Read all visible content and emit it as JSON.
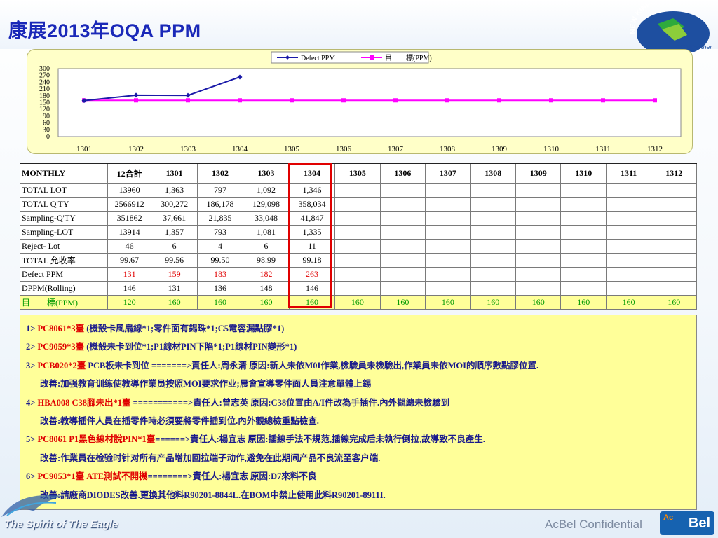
{
  "title": "康展2013年OQA PPM",
  "logo": {
    "arc_text": "NEW KINPO VALUE",
    "side_text_1": "COM",
    "side_text_2": "Partner"
  },
  "chart_data": {
    "type": "line",
    "categories": [
      "1301",
      "1302",
      "1303",
      "1304",
      "1305",
      "1306",
      "1307",
      "1308",
      "1309",
      "1310",
      "1311",
      "1312"
    ],
    "series": [
      {
        "name": "Defect PPM",
        "values": [
          159,
          183,
          182,
          263,
          null,
          null,
          null,
          null,
          null,
          null,
          null,
          null
        ],
        "color": "#1a1aa8"
      },
      {
        "name": "目　　標(PPM)",
        "values": [
          160,
          160,
          160,
          160,
          160,
          160,
          160,
          160,
          160,
          160,
          160,
          160
        ],
        "color": "#ff00ff"
      }
    ],
    "yticks": [
      "300",
      "270",
      "240",
      "210",
      "180",
      "150",
      "120",
      "90",
      "60",
      "30",
      "0"
    ],
    "ylim": [
      0,
      300
    ],
    "legend": "top-center",
    "grid": false
  },
  "table": {
    "headers": [
      "MONTHLY",
      "12合計",
      "1301",
      "1302",
      "1303",
      "1304",
      "1305",
      "1306",
      "1307",
      "1308",
      "1309",
      "1310",
      "1311",
      "1312"
    ],
    "rows": [
      {
        "label": "TOTAL  LOT",
        "cells": [
          "13960",
          "1,363",
          "797",
          "1,092",
          "1,346",
          "",
          "",
          "",
          "",
          "",
          "",
          "",
          ""
        ]
      },
      {
        "label": "TOTAL Q'TY",
        "cells": [
          "2566912",
          "300,272",
          "186,178",
          "129,098",
          "358,034",
          "",
          "",
          "",
          "",
          "",
          "",
          "",
          ""
        ]
      },
      {
        "label": "Sampling-Q'TY",
        "cells": [
          "351862",
          "37,661",
          "21,835",
          "33,048",
          "41,847",
          "",
          "",
          "",
          "",
          "",
          "",
          "",
          ""
        ]
      },
      {
        "label": "Sampling-LOT",
        "cells": [
          "13914",
          "1,357",
          "793",
          "1,081",
          "1,335",
          "",
          "",
          "",
          "",
          "",
          "",
          "",
          ""
        ]
      },
      {
        "label": "Reject- Lot",
        "cells": [
          "46",
          "6",
          "4",
          "6",
          "11",
          "",
          "",
          "",
          "",
          "",
          "",
          "",
          ""
        ]
      },
      {
        "label": "TOTAL 允收率",
        "cells": [
          "99.67",
          "99.56",
          "99.50",
          "98.99",
          "99.18",
          "",
          "",
          "",
          "",
          "",
          "",
          "",
          ""
        ]
      },
      {
        "label": "Defect PPM",
        "cells": [
          "131",
          "159",
          "183",
          "182",
          "263",
          "",
          "",
          "",
          "",
          "",
          "",
          "",
          ""
        ]
      },
      {
        "label": "DPPM(Rolling)",
        "cells": [
          "146",
          "131",
          "136",
          "148",
          "146",
          "",
          "",
          "",
          "",
          "",
          "",
          "",
          ""
        ]
      },
      {
        "label": "目　　標(PPM)",
        "cells": [
          "120",
          "160",
          "160",
          "160",
          "160",
          "160",
          "160",
          "160",
          "160",
          "160",
          "160",
          "160",
          "160"
        ]
      }
    ]
  },
  "notes": [
    {
      "prefix": "1> ",
      "red": "PC8061*3臺",
      "rest": " (機殼卡風扇線*1;零件面有錫珠*1;C5電容漏點膠*1)"
    },
    {
      "prefix": "2> ",
      "red": "PC9059*3臺",
      "rest": " (機殼未卡到位*1;P1線材PIN下陷*1;P1線材PIN變形*1)"
    },
    {
      "prefix": "3> ",
      "red": "PCB020*2臺",
      "rest": " PCB板未卡到位 =======>責任人:周永清 原因:新人未依M0I作業,檢驗員未檢驗出,作業員未依MOI的順序數點膠位置."
    },
    {
      "sub": "改善:加强教育训练使教導作業员按照MOI要求作业;晨會宣導零件面人員注意單體上錫"
    },
    {
      "prefix": "4> ",
      "red": "HBA008 C38腳未出*1臺",
      "rest": " ===========>責任人:曾志英 原因:C38位置由A/I件改為手插件.內外觀總未檢驗到"
    },
    {
      "sub": "改善:教導插件人員在插零件時必須要將零件插到位.內外觀總檢重點檢查."
    },
    {
      "prefix": "5> ",
      "red": "PC8061 P1黑色線材脫PIN*1臺",
      "rest": "======>責任人:楊宜志 原因:插線手法不規范,插線完成后未執行倒拉,故導致不良產生."
    },
    {
      "sub": "改善:作業員在检验时针对所有产品增加回拉端子动作,避免在此期间产品不良流至客户端."
    },
    {
      "prefix": "6> ",
      "red": "PC9053*1臺 ATE測試不開機",
      "rest": "========>責任人:楊宜志 原因:D7來料不良"
    },
    {
      "sub": "改善:請廠商DIODES改善.更換其他料R90201-8844L.在BOM中禁止使用此料R90201-8911I."
    }
  ],
  "footer": {
    "left": "The Spirit of The Eagle",
    "right": "AcBel Confidential",
    "brand_top": "Ac",
    "brand": "Bel"
  }
}
